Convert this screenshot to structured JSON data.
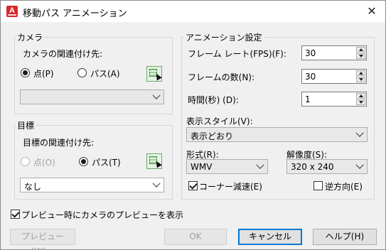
{
  "window": {
    "title": "移動パス アニメーション",
    "app_icon_letter": "A",
    "close_glyph": "✕"
  },
  "camera": {
    "group_label": "カメラ",
    "link_label": "カメラの関連付け先:",
    "radio_point": "点(P)",
    "radio_path": "パス(A)",
    "selected": "point",
    "dropdown_value": ""
  },
  "target": {
    "group_label": "目標",
    "link_label": "目標の関連付け先:",
    "radio_point": "点(O)",
    "radio_path": "パス(T)",
    "selected": "path",
    "dropdown_value": "なし"
  },
  "animation": {
    "group_label": "アニメーション設定",
    "frame_rate_label": "フレーム レート(FPS)(F):",
    "frame_rate_value": "30",
    "frame_count_label": "フレームの数(N):",
    "frame_count_value": "30",
    "duration_label": "時間(秒) (D):",
    "duration_value": "1",
    "style_label": "表示スタイル(V):",
    "style_value": "表示どおり",
    "format_label": "形式(R):",
    "format_value": "WMV",
    "resolution_label": "解像度(S):",
    "resolution_value": "320 x 240",
    "corner_decel_label": "コーナー減速(E)",
    "corner_decel_checked": true,
    "reverse_label": "逆方向(E)",
    "reverse_checked": false
  },
  "preview_toggle": {
    "label": "プレビュー時にカメラのプレビューを表示",
    "checked": true
  },
  "buttons": {
    "preview": "プレビュー(W)...",
    "ok": "OK",
    "cancel": "キャンセル",
    "help": "ヘルプ(H)"
  },
  "colors": {
    "app_icon": "#d9272e",
    "default_button_border": "#0078d7"
  }
}
